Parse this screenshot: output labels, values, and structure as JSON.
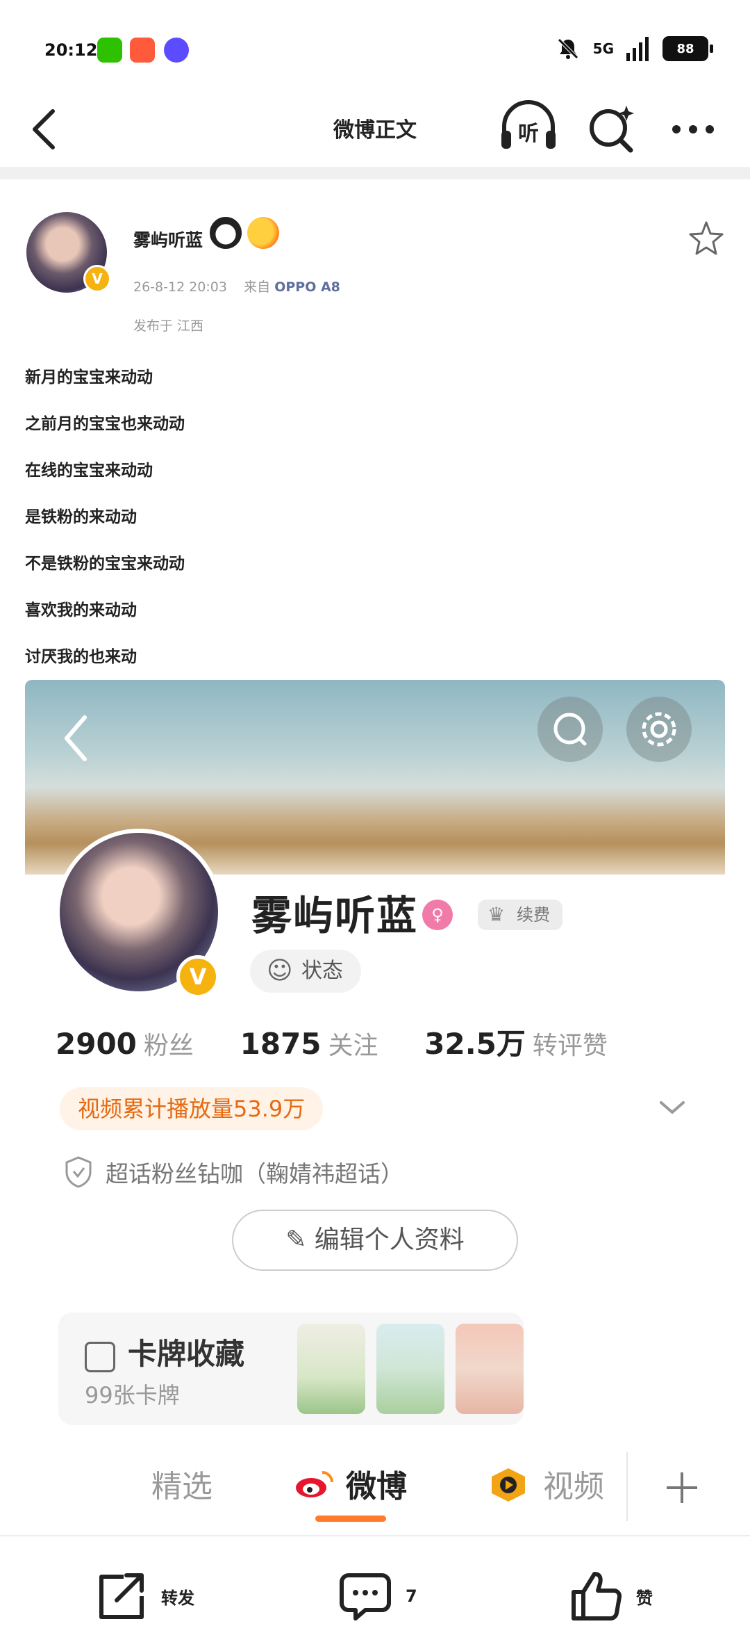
{
  "status_bar": {
    "time": "20:12",
    "network": "5G",
    "battery": "88",
    "icons": [
      "wechat-icon",
      "app-icon",
      "tieba-icon",
      "mute-bell-icon",
      "signal-icon",
      "battery-icon"
    ]
  },
  "nav": {
    "title": "微博正文",
    "listen_label": "听"
  },
  "post": {
    "author": "雾屿听蓝",
    "time": "26-8-12 20:03",
    "source_prefix": "来自",
    "source": "OPPO A8",
    "location": "发布于 江西",
    "lines": [
      "新月的宝宝来动动",
      "之前月的宝宝也来动动",
      "在线的宝宝来动动",
      "是铁粉的来动动",
      "不是铁粉的宝宝来动动",
      "喜欢我的来动动",
      "讨厌我的也来动"
    ]
  },
  "profile_screenshot": {
    "name": "雾屿听蓝",
    "renew": "续费",
    "status": "状态",
    "stats": [
      {
        "value": "2900",
        "label": "粉丝"
      },
      {
        "value": "1875",
        "label": "关注"
      },
      {
        "value": "32.5万",
        "label": "转评赞"
      }
    ],
    "video_plays": "视频累计播放量53.9万",
    "super_topic": "超话粉丝钻咖（鞠婧祎超话）",
    "edit_profile": "编辑个人资料",
    "cards_title": "卡牌收藏",
    "cards_count": "99张卡牌",
    "tabs": [
      "精选",
      "微博",
      "视频"
    ]
  },
  "actions": {
    "repost": "转发",
    "comment": "7",
    "like": "赞"
  },
  "colors": {
    "accent_orange": "#ff7a2a",
    "verified_gold": "#f6b20f",
    "source_blue": "#5f6f9c"
  }
}
